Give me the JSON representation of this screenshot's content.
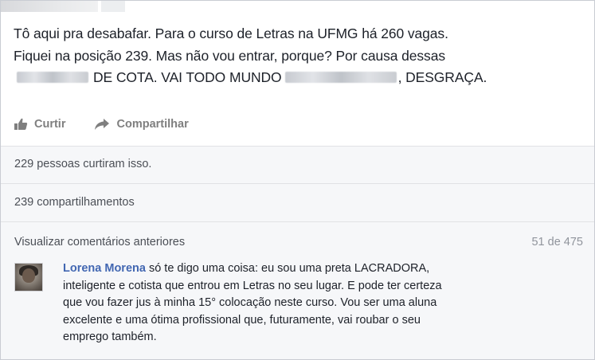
{
  "post": {
    "lines": [
      "Tô aqui pra desabafar. Para o curso de Letras na UFMG há 260 vagas.",
      "Fiquei na posição 239. Mas não vou entrar, porque? Por causa dessas"
    ],
    "line3_part1": "DE COTA. VAI TODO MUNDO",
    "line3_part2": ", DESGRAÇA."
  },
  "actions": {
    "like_label": "Curtir",
    "share_label": "Compartilhar",
    "like_icon": "thumbs-up-icon",
    "share_icon": "share-arrow-icon"
  },
  "feedback": {
    "likes_text": "229 pessoas curtiram isso.",
    "shares_text": "239 compartilhamentos",
    "view_previous": "Visualizar comentários anteriores",
    "pager": "51 de 475"
  },
  "comment": {
    "author": "Lorena Morena",
    "lines": [
      " só te digo uma coisa: eu sou uma preta LACRADORA,",
      "inteligente e cotista que entrou em Letras no seu lugar. E pode ter certeza",
      "que vou fazer jus à minha 15° colocação neste curso. Vou ser uma aluna",
      "excelente e uma ótima profissional que, futuramente, vai roubar o seu",
      "emprego também."
    ]
  },
  "colors": {
    "link": "#4267b2",
    "text": "#1d2129",
    "muted": "#7f7f7f",
    "feedback_bg": "#f6f7f9"
  }
}
